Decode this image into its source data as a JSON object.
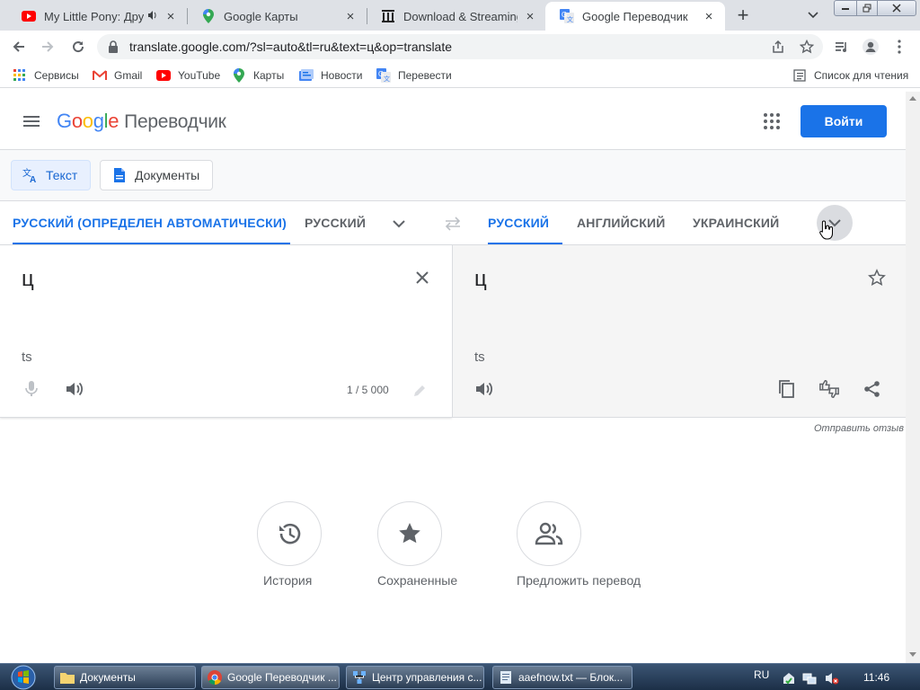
{
  "browser": {
    "tabs": [
      {
        "title": "My Little Pony: Друж",
        "favicon": "youtube-icon",
        "audio": "speaker-icon"
      },
      {
        "title": "Google Карты",
        "favicon": "maps-pin-icon"
      },
      {
        "title": "Download & Streaming :",
        "favicon": "archive-icon"
      },
      {
        "title": "Google Переводчик",
        "favicon": "translate-icon",
        "active": true
      }
    ],
    "url": "translate.google.com/?sl=auto&tl=ru&text=ц&op=translate",
    "bookmarks": [
      {
        "label": "Сервисы",
        "icon": "apps-grid-icon"
      },
      {
        "label": "Gmail",
        "icon": "gmail-icon"
      },
      {
        "label": "YouTube",
        "icon": "youtube-icon"
      },
      {
        "label": "Карты",
        "icon": "maps-pin-icon"
      },
      {
        "label": "Новости",
        "icon": "news-icon"
      },
      {
        "label": "Перевести",
        "icon": "translate-icon"
      }
    ],
    "reading_list": "Список для чтения"
  },
  "header": {
    "logo_letters": [
      "G",
      "o",
      "o",
      "g",
      "l",
      "e"
    ],
    "product": "Переводчик",
    "signin": "Войти"
  },
  "modes": {
    "text": "Текст",
    "documents": "Документы"
  },
  "source_langs": [
    "РУССКИЙ (ОПРЕДЕЛЕН АВТОМАТИЧЕСКИ)",
    "РУССКИЙ"
  ],
  "target_langs": [
    "РУССКИЙ",
    "АНГЛИЙСКИЙ",
    "УКРАИНСКИЙ"
  ],
  "source": {
    "text": "ц",
    "translit": "ts",
    "counter": "1 / 5 000"
  },
  "target": {
    "text": "ц",
    "translit": "ts"
  },
  "feedback": "Отправить отзыв",
  "shortcuts": [
    {
      "label": "История",
      "icon": "history-icon"
    },
    {
      "label": "Сохраненные",
      "icon": "star-icon"
    },
    {
      "label": "Предложить перевод",
      "icon": "people-icon"
    }
  ],
  "taskbar": {
    "items": [
      {
        "label": "Документы",
        "icon": "folder-icon"
      },
      {
        "label": "Google Переводчик ...",
        "icon": "chrome-icon"
      },
      {
        "label": "Центр управления с...",
        "icon": "network-icon"
      },
      {
        "label": "aaefnow.txt — Блок...",
        "icon": "notepad-icon"
      }
    ],
    "lang": "RU",
    "time": "11:46"
  },
  "colors": {
    "accent": "#1a73e8",
    "tabstrip": "#dee1e6",
    "taskbar": "#1c2f47"
  }
}
